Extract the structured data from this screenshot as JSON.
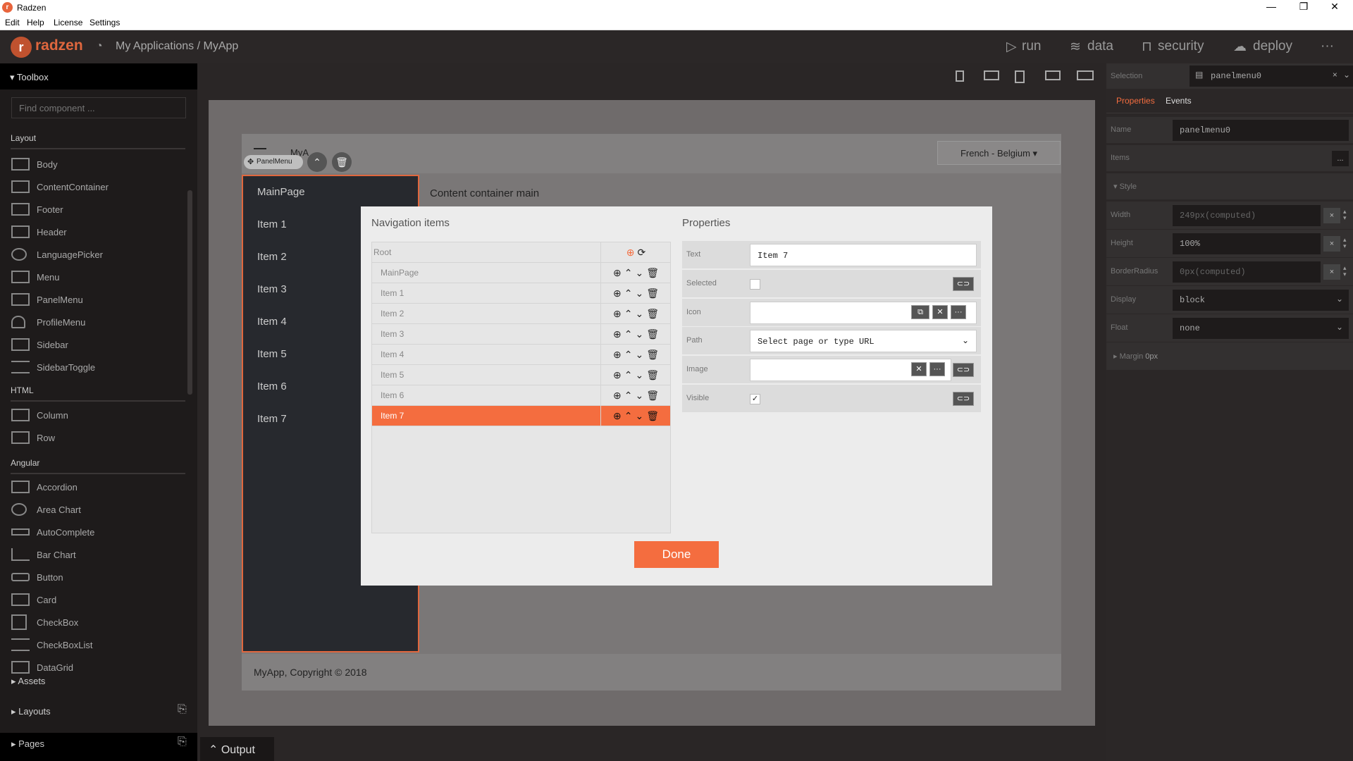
{
  "window": {
    "title": "Radzen",
    "minimize": "—",
    "restore": "❐",
    "close": "✕"
  },
  "menu": [
    "Edit",
    "Help",
    "License",
    "Settings"
  ],
  "appbar": {
    "logo": "radzen",
    "breadcrumb": "My Applications / MyApp",
    "nav": [
      "run",
      "data",
      "security",
      "deploy"
    ],
    "more": "···"
  },
  "toolbox": {
    "title": "Toolbox",
    "search_placeholder": "Find component ...",
    "sections": {
      "layout": {
        "title": "Layout",
        "items": [
          "Body",
          "ContentContainer",
          "Footer",
          "Header",
          "LanguagePicker",
          "Menu",
          "PanelMenu",
          "ProfileMenu",
          "Sidebar",
          "SidebarToggle"
        ]
      },
      "html": {
        "title": "HTML",
        "items": [
          "Column",
          "Row"
        ]
      },
      "angular": {
        "title": "Angular",
        "items": [
          "Accordion",
          "Area Chart",
          "AutoComplete",
          "Bar Chart",
          "Button",
          "Card",
          "CheckBox",
          "CheckBoxList",
          "DataGrid"
        ]
      }
    },
    "footer": [
      "Assets",
      "Layouts",
      "Pages"
    ]
  },
  "canvas": {
    "app_header": "MyA",
    "language": "French - Belgium",
    "panelmenu_tag": "PanelMenu",
    "panelmenu_items": [
      "MainPage",
      "Item 1",
      "Item 2",
      "Item 3",
      "Item 4",
      "Item 5",
      "Item 6",
      "Item 7"
    ],
    "content": "Content container main",
    "footer": "MyApp, Copyright © 2018"
  },
  "dialog": {
    "nav_title": "Navigation items",
    "props_title": "Properties",
    "root_label": "Root",
    "items": [
      "MainPage",
      "Item 1",
      "Item 2",
      "Item 3",
      "Item 4",
      "Item 5",
      "Item 6",
      "Item 7"
    ],
    "selected_index": 7,
    "properties": {
      "text_label": "Text",
      "text_value": "Item 7",
      "selected_label": "Selected",
      "icon_label": "Icon",
      "path_label": "Path",
      "path_value": "Select page or type URL",
      "image_label": "Image",
      "visible_label": "Visible"
    },
    "done": "Done"
  },
  "right": {
    "selection_label": "Selection",
    "selection_value": "panelmenu0",
    "tabs": [
      "Properties",
      "Events"
    ],
    "name_label": "Name",
    "name_value": "panelmenu0",
    "items_label": "Items",
    "items_btn": "...",
    "style_label": "Style",
    "width_label": "Width",
    "width_value": "249px(computed)",
    "height_label": "Height",
    "height_value": "100%",
    "radius_label": "BorderRadius",
    "radius_value": "0px(computed)",
    "display_label": "Display",
    "display_value": "block",
    "float_label": "Float",
    "float_value": "none",
    "margin_label": "Margin",
    "margin_value": "0px"
  },
  "output": "Output",
  "colors": {
    "accent": "#f46d3f",
    "brand": "#e0673e"
  }
}
